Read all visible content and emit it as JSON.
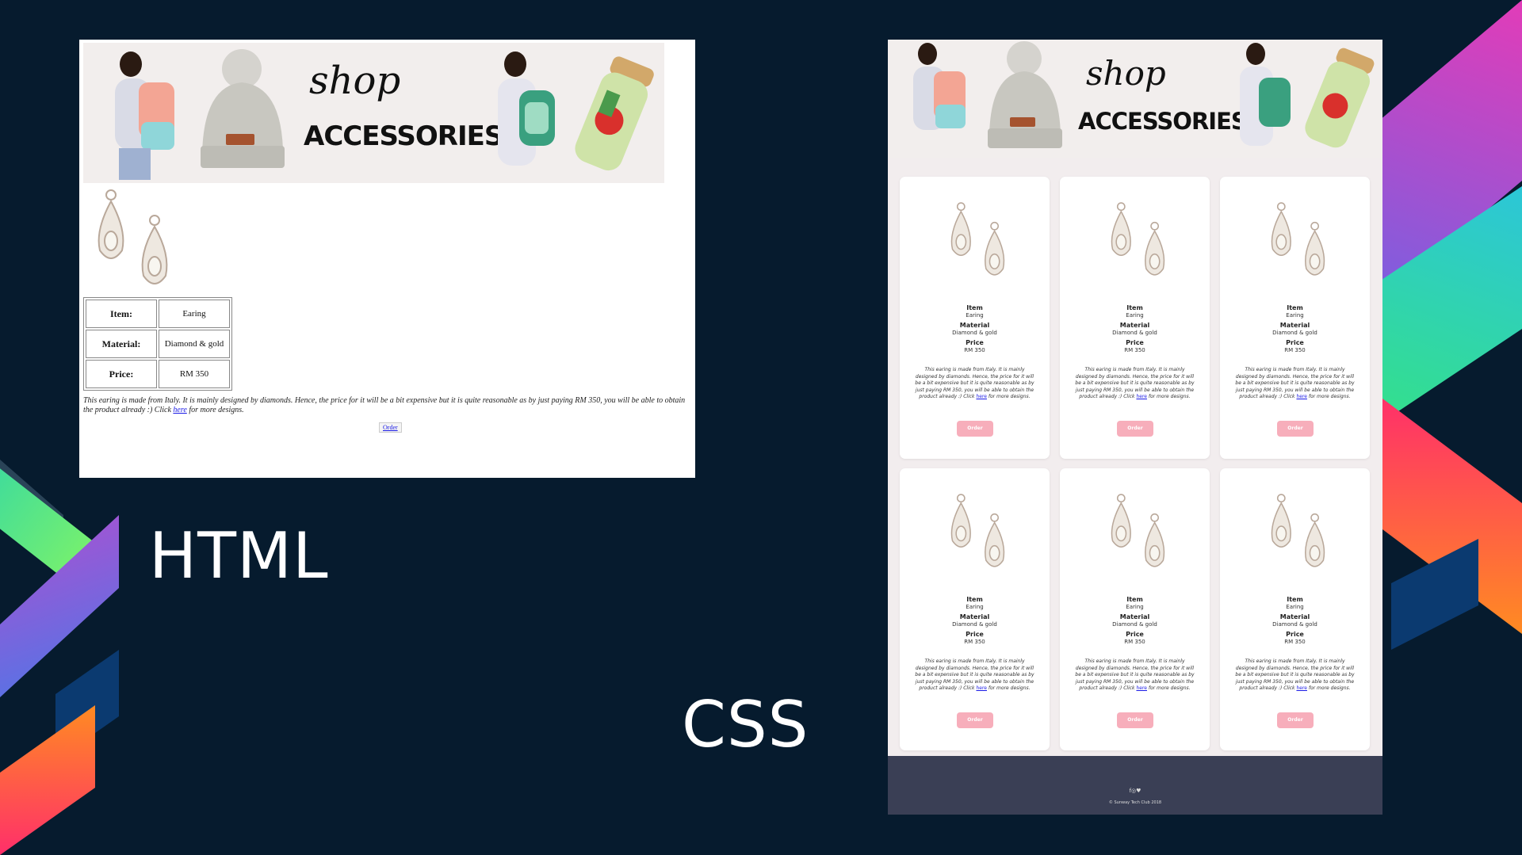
{
  "labels": {
    "html": "HTML",
    "css": "CSS"
  },
  "banner": {
    "title_script": "shop",
    "title_block": "ACCESSORIES"
  },
  "product": {
    "item_label": "Item:",
    "item_value": "Earing",
    "material_label": "Material:",
    "material_value": "Diamond & gold",
    "price_label": "Price:",
    "price_value": "RM 350",
    "description_pre": "This earing is made from Italy. It is mainly designed by diamonds. Hence, the price for it will be a bit expensive but it is quite reasonable as by just paying RM 350, you will be able to obtain the product already :) Click ",
    "description_link": "here",
    "description_post": " for more designs.",
    "order_label": "Order"
  },
  "card": {
    "item_label": "Item",
    "item_value": "Earing",
    "material_label": "Material",
    "material_value": "Diamond & gold",
    "price_label": "Price",
    "price_value": "RM 350",
    "description_pre": "This earing is made from Italy. It is mainly designed by diamonds. Hence, the price for it will be a bit expensive but it is quite reasonable as by just paying RM 350, you will be able to obtain the product already :) Click ",
    "description_link": "here",
    "description_post": " for more designs.",
    "order_label": "Order"
  },
  "footer": {
    "social_icons": [
      "facebook-icon",
      "instagram-icon",
      "twitter-icon"
    ],
    "social_text": "f◎♥",
    "copyright": "© Sunway Tech Club 2018"
  },
  "colors": {
    "background": "#061b2e",
    "order_button": "#f7aebb",
    "footer": "#3a3f55",
    "link": "#1a1ae6"
  }
}
